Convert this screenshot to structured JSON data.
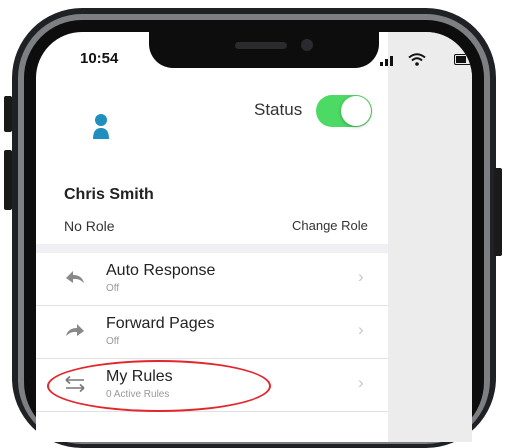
{
  "status_bar": {
    "time": "10:54"
  },
  "header": {
    "status_label": "Status",
    "status_on": true
  },
  "user": {
    "name": "Chris Smith",
    "role": "No Role",
    "change_role_label": "Change Role"
  },
  "menu": [
    {
      "title": "Auto Response",
      "subtitle": "Off",
      "icon": "reply-icon"
    },
    {
      "title": "Forward Pages",
      "subtitle": "Off",
      "icon": "forward-icon"
    },
    {
      "title": "My Rules",
      "subtitle": "0 Active Rules",
      "icon": "transfer-arrows-icon"
    }
  ],
  "colors": {
    "toggle": "#4cd964",
    "avatar": "#1f8fbf",
    "highlight": "#e3262b"
  }
}
